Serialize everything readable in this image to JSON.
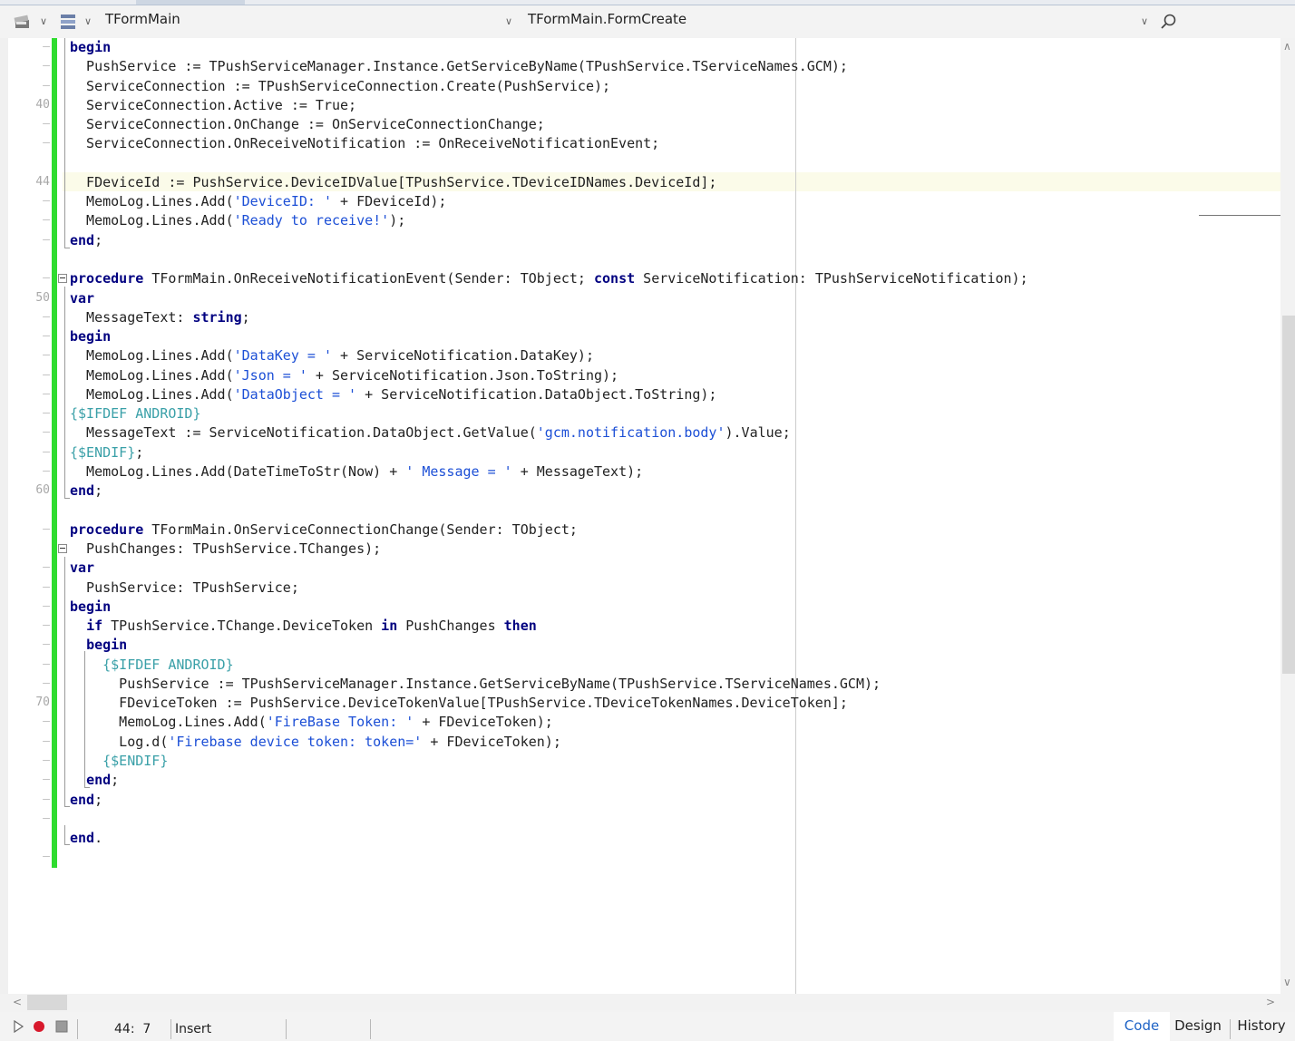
{
  "toolbar": {
    "class_combo_text": "TFormMain",
    "method_combo_text": "TFormMain.FormCreate"
  },
  "editor": {
    "gutter": [
      {
        "kind": "dash",
        "text": "–"
      },
      {
        "kind": "dash",
        "text": "–"
      },
      {
        "kind": "dash",
        "text": "–"
      },
      {
        "kind": "num",
        "text": "40"
      },
      {
        "kind": "dash",
        "text": "–"
      },
      {
        "kind": "dash",
        "text": "–"
      },
      {
        "kind": "dash",
        "text": ""
      },
      {
        "kind": "num",
        "text": "44"
      },
      {
        "kind": "dash",
        "text": "–"
      },
      {
        "kind": "dash",
        "text": "–"
      },
      {
        "kind": "dash",
        "text": "–"
      },
      {
        "kind": "dash",
        "text": ""
      },
      {
        "kind": "dash",
        "text": "–"
      },
      {
        "kind": "num",
        "text": "50"
      },
      {
        "kind": "dash",
        "text": "–"
      },
      {
        "kind": "dash",
        "text": "–"
      },
      {
        "kind": "dash",
        "text": "–"
      },
      {
        "kind": "dash",
        "text": "–"
      },
      {
        "kind": "dash",
        "text": "–"
      },
      {
        "kind": "dash",
        "text": "–"
      },
      {
        "kind": "dash",
        "text": "–"
      },
      {
        "kind": "dash",
        "text": "–"
      },
      {
        "kind": "dash",
        "text": "–"
      },
      {
        "kind": "num",
        "text": "60"
      },
      {
        "kind": "dash",
        "text": ""
      },
      {
        "kind": "dash",
        "text": "–"
      },
      {
        "kind": "dash",
        "text": ""
      },
      {
        "kind": "dash",
        "text": "–"
      },
      {
        "kind": "dash",
        "text": "–"
      },
      {
        "kind": "dash",
        "text": "–"
      },
      {
        "kind": "dash",
        "text": "–"
      },
      {
        "kind": "dash",
        "text": "–"
      },
      {
        "kind": "dash",
        "text": "–"
      },
      {
        "kind": "dash",
        "text": "–"
      },
      {
        "kind": "num",
        "text": "70"
      },
      {
        "kind": "dash",
        "text": "–"
      },
      {
        "kind": "dash",
        "text": "–"
      },
      {
        "kind": "dash",
        "text": "–"
      },
      {
        "kind": "dash",
        "text": "–"
      },
      {
        "kind": "dash",
        "text": "–"
      },
      {
        "kind": "dash",
        "text": "–"
      },
      {
        "kind": "dash",
        "text": ""
      },
      {
        "kind": "dash",
        "text": "–"
      }
    ],
    "lines": [
      [
        [
          "k",
          "begin"
        ]
      ],
      [
        [
          "n",
          "  PushService := TPushServiceManager.Instance.GetServiceByName(TPushService.TServiceNames.GCM);"
        ]
      ],
      [
        [
          "n",
          "  ServiceConnection := TPushServiceConnection.Create(PushService);"
        ]
      ],
      [
        [
          "n",
          "  ServiceConnection.Active := True;"
        ]
      ],
      [
        [
          "n",
          "  ServiceConnection.OnChange := OnServiceConnectionChange;"
        ]
      ],
      [
        [
          "n",
          "  ServiceConnection.OnReceiveNotification := OnReceiveNotificationEvent;"
        ]
      ],
      [],
      [
        [
          "n",
          "  FDeviceId := PushService.DeviceIDValue[TPushService.TDeviceIDNames.DeviceId];"
        ]
      ],
      [
        [
          "n",
          "  MemoLog.Lines.Add("
        ],
        [
          "s",
          "'DeviceID: '"
        ],
        [
          "n",
          " + FDeviceId);"
        ]
      ],
      [
        [
          "n",
          "  MemoLog.Lines.Add("
        ],
        [
          "s",
          "'Ready to receive!'"
        ],
        [
          "n",
          ");"
        ]
      ],
      [
        [
          "k",
          "end"
        ],
        [
          "n",
          ";"
        ]
      ],
      [],
      [
        [
          "k",
          "procedure"
        ],
        [
          "n",
          " TFormMain.OnReceiveNotificationEvent(Sender: TObject; "
        ],
        [
          "k",
          "const"
        ],
        [
          "n",
          " ServiceNotification: TPushServiceNotification);"
        ]
      ],
      [
        [
          "k",
          "var"
        ]
      ],
      [
        [
          "n",
          "  MessageText: "
        ],
        [
          "k",
          "string"
        ],
        [
          "n",
          ";"
        ]
      ],
      [
        [
          "k",
          "begin"
        ]
      ],
      [
        [
          "n",
          "  MemoLog.Lines.Add("
        ],
        [
          "s",
          "'DataKey = '"
        ],
        [
          "n",
          " + ServiceNotification.DataKey);"
        ]
      ],
      [
        [
          "n",
          "  MemoLog.Lines.Add("
        ],
        [
          "s",
          "'Json = '"
        ],
        [
          "n",
          " + ServiceNotification.Json.ToString);"
        ]
      ],
      [
        [
          "n",
          "  MemoLog.Lines.Add("
        ],
        [
          "s",
          "'DataObject = '"
        ],
        [
          "n",
          " + ServiceNotification.DataObject.ToString);"
        ]
      ],
      [
        [
          "d",
          "{$IFDEF ANDROID}"
        ]
      ],
      [
        [
          "n",
          "  MessageText := ServiceNotification.DataObject.GetValue("
        ],
        [
          "s",
          "'gcm.notification.body'"
        ],
        [
          "n",
          ").Value;"
        ]
      ],
      [
        [
          "d",
          "{$ENDIF}"
        ],
        [
          "n",
          ";"
        ]
      ],
      [
        [
          "n",
          "  MemoLog.Lines.Add(DateTimeToStr(Now) + "
        ],
        [
          "s",
          "' Message = '"
        ],
        [
          "n",
          " + MessageText);"
        ]
      ],
      [
        [
          "k",
          "end"
        ],
        [
          "n",
          ";"
        ]
      ],
      [],
      [
        [
          "k",
          "procedure"
        ],
        [
          "n",
          " TFormMain.OnServiceConnectionChange(Sender: TObject;"
        ]
      ],
      [
        [
          "n",
          "  PushChanges: TPushService.TChanges);"
        ]
      ],
      [
        [
          "k",
          "var"
        ]
      ],
      [
        [
          "n",
          "  PushService: TPushService;"
        ]
      ],
      [
        [
          "k",
          "begin"
        ]
      ],
      [
        [
          "n",
          "  "
        ],
        [
          "k",
          "if"
        ],
        [
          "n",
          " TPushService.TChange.DeviceToken "
        ],
        [
          "k",
          "in"
        ],
        [
          "n",
          " PushChanges "
        ],
        [
          "k",
          "then"
        ]
      ],
      [
        [
          "n",
          "  "
        ],
        [
          "k",
          "begin"
        ]
      ],
      [
        [
          "n",
          "    "
        ],
        [
          "d",
          "{$IFDEF ANDROID}"
        ]
      ],
      [
        [
          "n",
          "      PushService := TPushServiceManager.Instance.GetServiceByName(TPushService.TServiceNames.GCM);"
        ]
      ],
      [
        [
          "n",
          "      FDeviceToken := PushService.DeviceTokenValue[TPushService.TDeviceTokenNames.DeviceToken];"
        ]
      ],
      [
        [
          "n",
          "      MemoLog.Lines.Add("
        ],
        [
          "s",
          "'FireBase Token: '"
        ],
        [
          "n",
          " + FDeviceToken);"
        ]
      ],
      [
        [
          "n",
          "      Log.d("
        ],
        [
          "s",
          "'Firebase device token: token='"
        ],
        [
          "n",
          " + FDeviceToken);"
        ]
      ],
      [
        [
          "n",
          "    "
        ],
        [
          "d",
          "{$ENDIF}"
        ]
      ],
      [
        [
          "n",
          "  "
        ],
        [
          "k",
          "end"
        ],
        [
          "n",
          ";"
        ]
      ],
      [
        [
          "k",
          "end"
        ],
        [
          "n",
          ";"
        ]
      ],
      [],
      [
        [
          "k",
          "end"
        ],
        [
          "n",
          "."
        ]
      ]
    ]
  },
  "statusbar": {
    "position": "44:  7",
    "mode": "Insert"
  },
  "bottom_tabs": {
    "code": "Code",
    "design": "Design",
    "history": "History"
  },
  "colors": {
    "keyword": "#000080",
    "string": "#1c4fd6",
    "directive": "#3aa0a8",
    "modified_bar": "#2fdc2f",
    "active_tab": "#1e63c6"
  }
}
